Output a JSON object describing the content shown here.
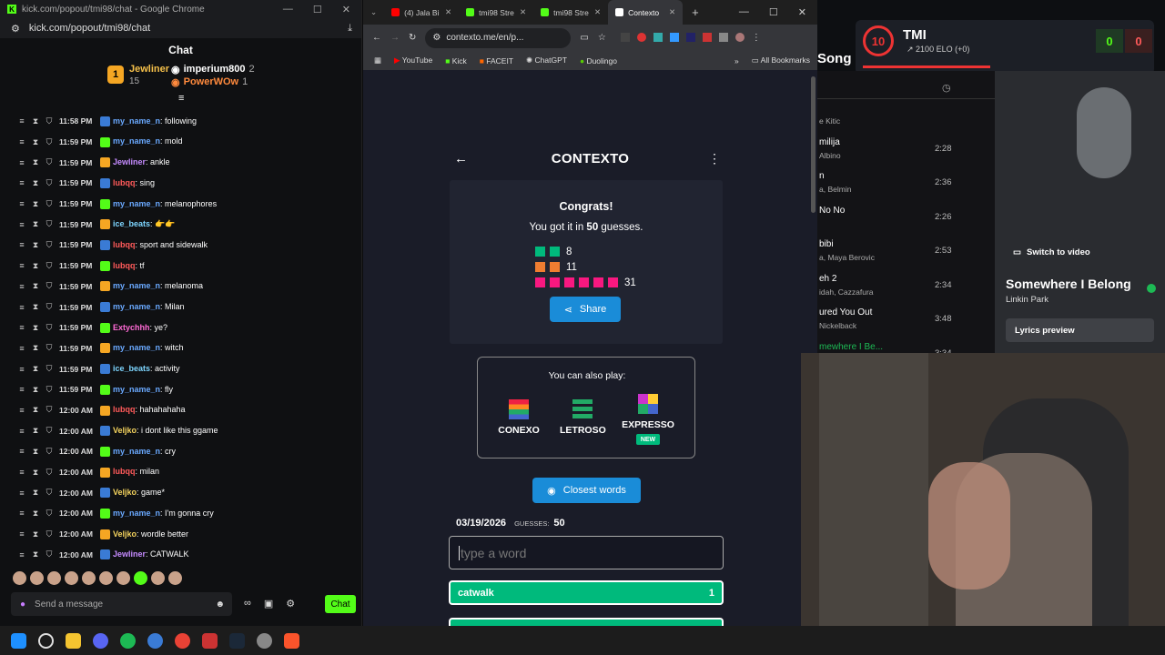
{
  "chat_window": {
    "title": "kick.com/popout/tmi98/chat - Google Chrome",
    "url": "kick.com/popout/tmi98/chat",
    "header": "Chat",
    "leaderboard": [
      {
        "rank": "1",
        "name": "Jewliner",
        "count": "15"
      },
      {
        "name": "imperium800",
        "count": "2"
      },
      {
        "name": "PowerWOw",
        "count": "1"
      }
    ],
    "messages": [
      {
        "time": "11:58 PM",
        "user": "my_name_n",
        "text": ": following",
        "color": "#6aa9ff"
      },
      {
        "time": "11:59 PM",
        "user": "my_name_n",
        "text": ": mold",
        "color": "#6aa9ff"
      },
      {
        "time": "11:59 PM",
        "user": "Jewliner",
        "text": ": ankle",
        "color": "#c58bff"
      },
      {
        "time": "11:59 PM",
        "user": "lubqq",
        "text": ": sing",
        "color": "#ff5a5a"
      },
      {
        "time": "11:59 PM",
        "user": "my_name_n",
        "text": ": melanophores",
        "color": "#6aa9ff"
      },
      {
        "time": "11:59 PM",
        "user": "ice_beats",
        "text": ": 👉👉",
        "color": "#7ed6ff"
      },
      {
        "time": "11:59 PM",
        "user": "lubqq",
        "text": ": sport and sidewalk",
        "color": "#ff5a5a"
      },
      {
        "time": "11:59 PM",
        "user": "lubqq",
        "text": ": tf",
        "color": "#ff5a5a"
      },
      {
        "time": "11:59 PM",
        "user": "my_name_n",
        "text": ": melanoma",
        "color": "#6aa9ff"
      },
      {
        "time": "11:59 PM",
        "user": "my_name_n",
        "text": ": Milan",
        "color": "#6aa9ff"
      },
      {
        "time": "11:59 PM",
        "user": "Extychhh",
        "text": ": ye?",
        "color": "#ff6ad5"
      },
      {
        "time": "11:59 PM",
        "user": "my_name_n",
        "text": ": witch",
        "color": "#6aa9ff"
      },
      {
        "time": "11:59 PM",
        "user": "ice_beats",
        "text": ": activity",
        "color": "#7ed6ff"
      },
      {
        "time": "11:59 PM",
        "user": "my_name_n",
        "text": ": fly",
        "color": "#6aa9ff"
      },
      {
        "time": "12:00 AM",
        "user": "lubqq",
        "text": ": hahahahaha",
        "color": "#ff5a5a"
      },
      {
        "time": "12:00 AM",
        "user": "Veljko",
        "text": ": i dont like this ggame",
        "color": "#f4d35e"
      },
      {
        "time": "12:00 AM",
        "user": "my_name_n",
        "text": ": cry",
        "color": "#6aa9ff"
      },
      {
        "time": "12:00 AM",
        "user": "lubqq",
        "text": ": milan",
        "color": "#ff5a5a"
      },
      {
        "time": "12:00 AM",
        "user": "Veljko",
        "text": ": game*",
        "color": "#f4d35e"
      },
      {
        "time": "12:00 AM",
        "user": "my_name_n",
        "text": ": I'm gonna cry",
        "color": "#6aa9ff"
      },
      {
        "time": "12:00 AM",
        "user": "Veljko",
        "text": ": wordle better",
        "color": "#f4d35e"
      },
      {
        "time": "12:00 AM",
        "user": "Jewliner",
        "text": ": CATWALK",
        "color": "#c58bff"
      }
    ],
    "input_placeholder": "Send a message",
    "chat_button": "Chat"
  },
  "browser": {
    "tabs": [
      {
        "label": "(4) Jala Bi",
        "color": "#ff0000"
      },
      {
        "label": "tmi98 Stre",
        "color": "#53fc18"
      },
      {
        "label": "tmi98 Stre",
        "color": "#53fc18"
      },
      {
        "label": "Contexto",
        "color": "#ffffff",
        "active": true
      }
    ],
    "url": "contexto.me/en/p...",
    "bookmarks": [
      "YouTube",
      "Kick",
      "FACEIT",
      "ChatGPT",
      "Duolingo"
    ],
    "all_bookmarks": "All Bookmarks"
  },
  "contexto": {
    "title": "CONTEXTO",
    "congrats": "Congrats!",
    "guesses_prefix": "You got it in ",
    "guesses_count": "50",
    "guesses_suffix": " guesses.",
    "result_rows": [
      {
        "count": "8",
        "color": "#00ba7c",
        "squares": 2
      },
      {
        "count": "11",
        "color": "#ef7d31",
        "squares": 2
      },
      {
        "count": "31",
        "color": "#f91880",
        "squares": 6
      }
    ],
    "share": "Share",
    "also_play": "You can also play:",
    "games": [
      "CONEXO",
      "LETROSO",
      "EXPRESSO"
    ],
    "new_badge": "NEW",
    "closest": "Closest words",
    "date": "03/19/2026",
    "guesses_label": "GUESSES:",
    "guesses_value": "50",
    "input_placeholder": "type a word",
    "top_word": "catwalk",
    "top_rank": "1"
  },
  "stream": {
    "streamer": "TMI",
    "level": "10",
    "elo": "2100 ELO (+0)",
    "score_left": "0",
    "score_right": "0",
    "spotify_header": "Song",
    "songs": [
      {
        "name": "",
        "artist": "e Kitic",
        "dur": ""
      },
      {
        "name": "milija",
        "artist": "Albino",
        "dur": "2:28"
      },
      {
        "name": "n",
        "artist": "a, Belmin",
        "dur": "2:36"
      },
      {
        "name": "No No",
        "artist": "",
        "dur": "2:26"
      },
      {
        "name": "bibi",
        "artist": "a, Maya Berovic",
        "dur": "2:53"
      },
      {
        "name": "eh 2",
        "artist": "idah, Cazzafura",
        "dur": "2:34"
      },
      {
        "name": "ured You Out",
        "artist": "Nickelback",
        "dur": "3:48"
      },
      {
        "name": "mewhere I Be...",
        "artist": "Linkin Park",
        "dur": "3:34"
      }
    ],
    "switch_video": "Switch to video",
    "now_playing_title": "Somewhere I Belong",
    "now_playing_artist": "Linkin Park",
    "lyrics": "Lyrics preview"
  }
}
